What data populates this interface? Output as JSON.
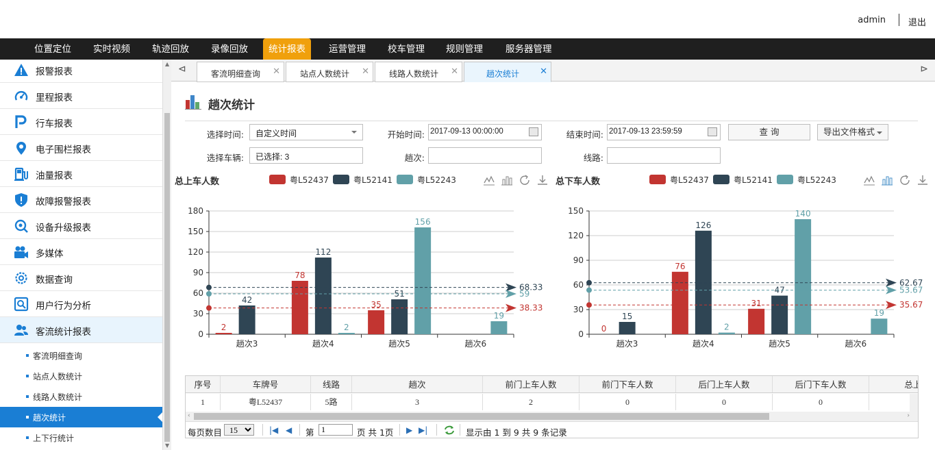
{
  "header": {
    "user": "admin",
    "logout": "退出"
  },
  "nav": [
    {
      "label": "位置定位",
      "active": false
    },
    {
      "label": "实时视频",
      "active": false
    },
    {
      "label": "轨迹回放",
      "active": false
    },
    {
      "label": "录像回放",
      "active": false
    },
    {
      "label": "统计报表",
      "active": true
    },
    {
      "label": "运营管理",
      "active": false
    },
    {
      "label": "校车管理",
      "active": false
    },
    {
      "label": "规则管理",
      "active": false
    },
    {
      "label": "服务器管理",
      "active": false
    }
  ],
  "sidebar": {
    "items": [
      {
        "label": "报警报表",
        "icon": "warning-icon"
      },
      {
        "label": "里程报表",
        "icon": "speedometer-icon"
      },
      {
        "label": "行车报表",
        "icon": "parking-icon"
      },
      {
        "label": "电子围栏报表",
        "icon": "location-pin-icon"
      },
      {
        "label": "油量报表",
        "icon": "fuel-pump-icon"
      },
      {
        "label": "故障报警报表",
        "icon": "shield-alert-icon"
      },
      {
        "label": "设备升级报表",
        "icon": "device-upgrade-icon"
      },
      {
        "label": "多媒体",
        "icon": "video-camera-icon"
      },
      {
        "label": "数据查询",
        "icon": "settings-search-icon"
      },
      {
        "label": "用户行为分析",
        "icon": "search-screen-icon"
      },
      {
        "label": "客流统计报表",
        "icon": "users-icon"
      }
    ],
    "subitems": [
      {
        "label": "客流明细查询",
        "active": false
      },
      {
        "label": "站点人数统计",
        "active": false
      },
      {
        "label": "线路人数统计",
        "active": false
      },
      {
        "label": "趟次统计",
        "active": true
      },
      {
        "label": "上下行统计",
        "active": false
      }
    ]
  },
  "tabs": [
    {
      "label": "客流明细查询",
      "active": false
    },
    {
      "label": "站点人数统计",
      "active": false
    },
    {
      "label": "线路人数统计",
      "active": false
    },
    {
      "label": "趟次统计",
      "active": true
    }
  ],
  "page": {
    "title": "趟次统计"
  },
  "filter": {
    "time_label": "选择时间:",
    "time_value": "自定义时间",
    "start_label": "开始时间:",
    "start_value": "2017-09-13 00:00:00",
    "end_label": "结束时间:",
    "end_value": "2017-09-13 23:59:59",
    "query_button": "查 询",
    "export_button": "导出文件格式",
    "vehicle_label": "选择车辆:",
    "vehicle_value": "已选择: 3",
    "trip_label": "趟次:",
    "trip_value": "",
    "route_label": "线路:",
    "route_value": ""
  },
  "colors": {
    "series1": "#c23531",
    "series2": "#2f4554",
    "series3": "#61a0a8",
    "nav_active": "#f0a00c",
    "sidebar_active": "#1a7ed4"
  },
  "chart_data": [
    {
      "type": "bar",
      "title": "总上车人数",
      "categories": [
        "趟次3",
        "趟次4",
        "趟次5",
        "趟次6"
      ],
      "series": [
        {
          "name": "粤L52437",
          "values": [
            2,
            78,
            35,
            null
          ],
          "average": 38.33
        },
        {
          "name": "粤L52141",
          "values": [
            42,
            112,
            51,
            null
          ],
          "average": 68.33
        },
        {
          "name": "粤L52243",
          "values": [
            null,
            2,
            156,
            19
          ],
          "average": 59
        }
      ],
      "ylim": [
        0,
        180
      ],
      "yticks": [
        0,
        30,
        60,
        90,
        120,
        150,
        180
      ],
      "legend": "top",
      "grid": true
    },
    {
      "type": "bar",
      "title": "总下车人数",
      "categories": [
        "趟次3",
        "趟次4",
        "趟次5",
        "趟次6"
      ],
      "series": [
        {
          "name": "粤L52437",
          "values": [
            0,
            76,
            31,
            null
          ],
          "average": 35.67
        },
        {
          "name": "粤L52141",
          "values": [
            15,
            126,
            47,
            null
          ],
          "average": 62.67
        },
        {
          "name": "粤L52243",
          "values": [
            null,
            2,
            140,
            19
          ],
          "average": 53.67
        }
      ],
      "ylim": [
        0,
        150
      ],
      "yticks": [
        0,
        30,
        60,
        90,
        120,
        150
      ],
      "legend": "top",
      "grid": true
    }
  ],
  "table": {
    "columns": [
      "序号",
      "车牌号",
      "线路",
      "趟次",
      "前门上车人数",
      "前门下车人数",
      "后门上车人数",
      "后门下车人数",
      "总上车"
    ],
    "rows": [
      [
        "1",
        "粤L52437",
        "5路",
        "3",
        "2",
        "0",
        "0",
        "0",
        ""
      ]
    ]
  },
  "pager": {
    "per_page_label": "每页数目",
    "per_page_value": "15",
    "page_prefix": "第",
    "page_value": "1",
    "page_suffix": "页 共 1页",
    "summary": "显示由 1 到 9 共 9 条记录"
  }
}
